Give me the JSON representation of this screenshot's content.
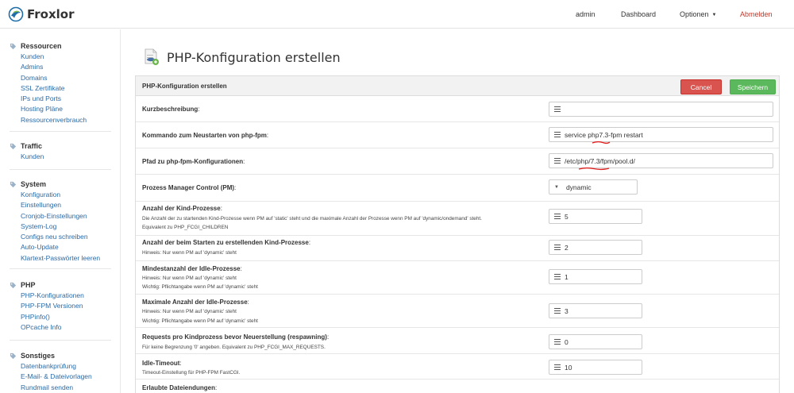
{
  "brand": {
    "name": "Froxlor"
  },
  "topnav": {
    "user": "admin",
    "dashboard": "Dashboard",
    "options": "Optionen",
    "logout": "Abmelden"
  },
  "sidebar": {
    "sections": [
      {
        "title": "Ressourcen",
        "items": [
          "Kunden",
          "Admins",
          "Domains",
          "SSL Zertifikate",
          "IPs und Ports",
          "Hosting Pläne",
          "Ressourcenverbrauch"
        ]
      },
      {
        "title": "Traffic",
        "items": [
          "Kunden"
        ]
      },
      {
        "title": "System",
        "items": [
          "Konfiguration",
          "Einstellungen",
          "Cronjob-Einstellungen",
          "System-Log",
          "Configs neu schreiben",
          "Auto-Update",
          "Klartext-Passwörter leeren"
        ]
      },
      {
        "title": "PHP",
        "items": [
          "PHP-Konfigurationen",
          "PHP-FPM Versionen",
          "PHPinfo()",
          "OPcache Info"
        ]
      },
      {
        "title": "Sonstiges",
        "items": [
          "Datenbankprüfung",
          "E-Mail- & Dateivorlagen",
          "Rundmail senden"
        ]
      }
    ]
  },
  "page": {
    "title": "PHP-Konfiguration erstellen"
  },
  "panel": {
    "title": "PHP-Konfiguration erstellen",
    "cancel": "Cancel",
    "save": "Speichern"
  },
  "form": {
    "kurzbeschreibung": {
      "label": "Kurzbeschreibung",
      "value": ""
    },
    "restart_cmd": {
      "label": "Kommando zum Neustarten von php-fpm",
      "value": "service php7.3-fpm restart"
    },
    "config_path": {
      "label": "Pfad zu php-fpm-Konfigurationen",
      "value": "/etc/php/7.3/fpm/pool.d/"
    },
    "pm": {
      "label": "Prozess Manager Control (PM)",
      "value": "dynamic"
    },
    "max_children": {
      "label": "Anzahl der Kind-Prozesse",
      "hint1": "Die Anzahl der zu startenden Kind-Prozesse wenn PM auf 'static' steht und die maximale Anzahl der Prozesse wenn PM auf 'dynamic/ondemand' steht.",
      "hint2": "Equivalent zu PHP_FCGI_CHILDREN",
      "value": "5"
    },
    "start_servers": {
      "label": "Anzahl der beim Starten zu erstellenden Kind-Prozesse",
      "hint1": "Hinweis: Nur wenn PM auf 'dynamic' steht",
      "value": "2"
    },
    "min_spare": {
      "label": "Mindestanzahl der Idle-Prozesse",
      "hint1": "Hinweis: Nur wenn PM auf 'dynamic' steht",
      "hint2": "Wichtig: Pflichtangabe wenn PM auf 'dynamic' steht",
      "value": "1"
    },
    "max_spare": {
      "label": "Maximale Anzahl der Idle-Prozesse",
      "hint1": "Hinweis: Nur wenn PM auf 'dynamic' steht",
      "hint2": "Wichtig: Pflichtangabe wenn PM auf 'dynamic' steht",
      "value": "3"
    },
    "max_requests": {
      "label": "Requests pro Kindprozess bevor Neuerstellung (respawning)",
      "hint1": "Für keine Begrenzung '0' angeben. Equivalent zu PHP_FCGI_MAX_REQUESTS.",
      "value": "0"
    },
    "idle_timeout": {
      "label": "Idle-Timeout",
      "hint1": "Timeout-Einstellung für PHP-FPM FastCGI.",
      "value": "10"
    },
    "allowed_ext": {
      "label": "Erlaubte Dateiendungen"
    }
  },
  "colors": {
    "link": "#2a6aa8",
    "danger": "#d9534f",
    "success": "#5cb85c",
    "annotation": "#e02020"
  }
}
